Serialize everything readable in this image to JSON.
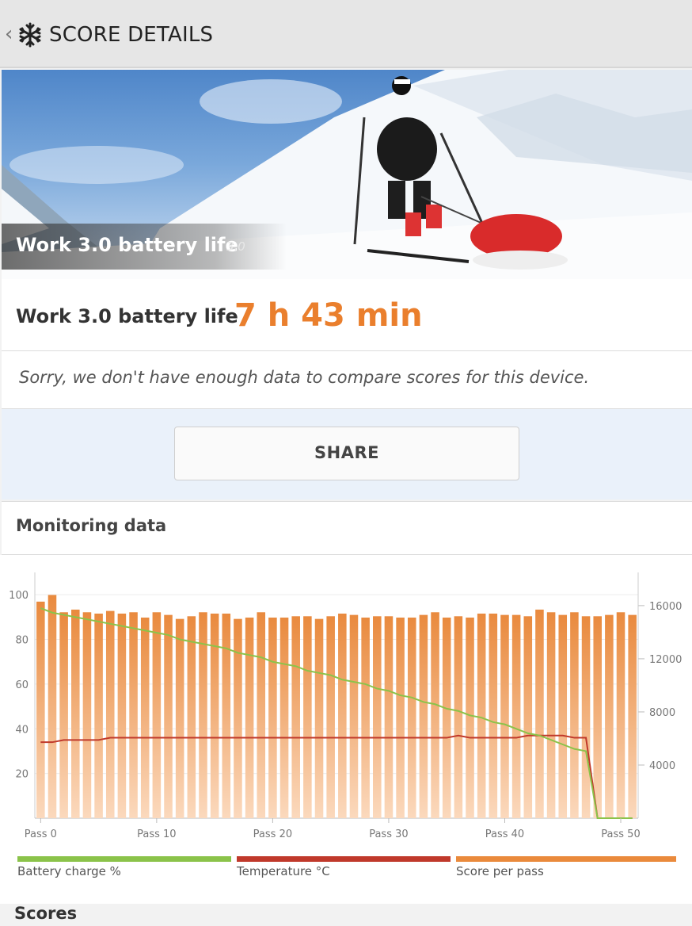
{
  "header": {
    "title": "SCORE DETAILS",
    "back_icon": "chevron-left-icon",
    "logo_icon": "snowflake-icon"
  },
  "hero": {
    "title": "Work 3.0 battery life",
    "version": "3.0"
  },
  "result": {
    "label": "Work 3.0 battery life",
    "value": "7 h 43 min",
    "accent": "#ea7f2d"
  },
  "notice": {
    "text": "Sorry, we don't have enough data to compare scores for this device."
  },
  "share": {
    "label": "SHARE"
  },
  "monitoring": {
    "title": "Monitoring data"
  },
  "chart_data": {
    "type": "bar",
    "left_axis": {
      "ticks": [
        "20",
        "40",
        "60",
        "80",
        "100"
      ],
      "ylim": [
        0,
        110
      ]
    },
    "right_axis": {
      "ticks": [
        "4000",
        "8000",
        "12000",
        "16000"
      ],
      "ylim": [
        0,
        18500
      ]
    },
    "x_tick_labels": [
      "Pass 0",
      "Pass 10",
      "Pass 20",
      "Pass 30",
      "Pass 40",
      "Pass 50"
    ],
    "score_per_pass": [
      16300,
      16800,
      15500,
      15700,
      15500,
      15400,
      15600,
      15400,
      15500,
      15100,
      15500,
      15300,
      15000,
      15200,
      15500,
      15400,
      15400,
      15000,
      15100,
      15500,
      15100,
      15100,
      15200,
      15200,
      15000,
      15200,
      15400,
      15300,
      15100,
      15200,
      15200,
      15100,
      15100,
      15300,
      15500,
      15100,
      15200,
      15100,
      15400,
      15400,
      15300,
      15300,
      15200,
      15700,
      15500,
      15300,
      15500,
      15200,
      15200,
      15300,
      15500,
      15300
    ],
    "battery_charge": [
      94,
      92,
      91,
      90,
      89,
      88,
      87,
      86,
      85,
      84,
      83,
      82,
      80,
      79,
      78,
      77,
      76,
      74,
      73,
      72,
      70,
      69,
      68,
      66,
      65,
      64,
      62,
      61,
      60,
      58,
      57,
      55,
      54,
      52,
      51,
      49,
      48,
      46,
      45,
      43,
      42,
      40,
      38,
      37,
      35,
      33,
      31,
      30,
      0,
      0,
      0,
      0
    ],
    "temperature": [
      34,
      34,
      35,
      35,
      35,
      35,
      36,
      36,
      36,
      36,
      36,
      36,
      36,
      36,
      36,
      36,
      36,
      36,
      36,
      36,
      36,
      36,
      36,
      36,
      36,
      36,
      36,
      36,
      36,
      36,
      36,
      36,
      36,
      36,
      36,
      36,
      37,
      36,
      36,
      36,
      36,
      36,
      37,
      37,
      37,
      37,
      36,
      36,
      0,
      0,
      0,
      0
    ],
    "series": [
      {
        "name": "Battery charge %",
        "color": "#8bc34a"
      },
      {
        "name": "Temperature °C",
        "color": "#c0392b"
      },
      {
        "name": "Score per pass",
        "color": "#ea8a3c"
      }
    ]
  },
  "scores": {
    "title": "Scores"
  }
}
